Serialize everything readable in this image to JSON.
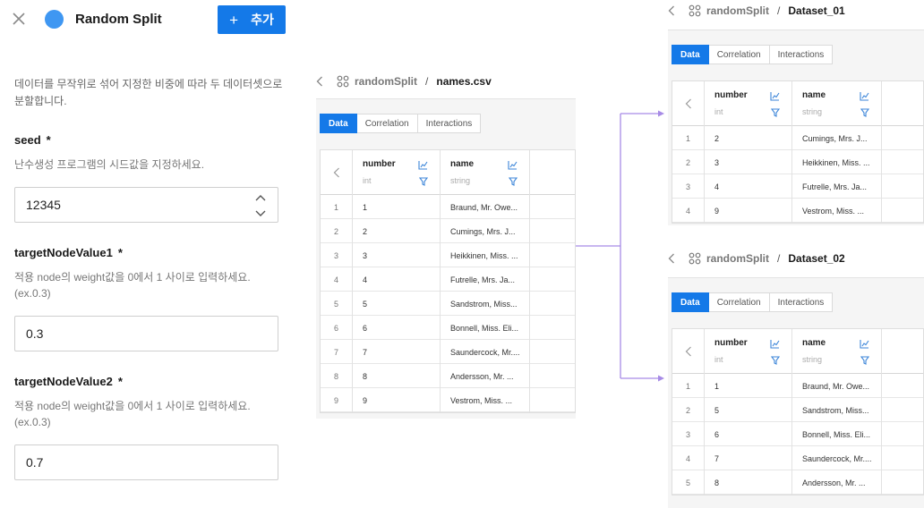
{
  "panel": {
    "title": "Random Split",
    "add_label": "추가",
    "description": "데이터를 무작위로 섞어 지정한 비중에 따라 두 데이터셋으로 분할합니다.",
    "fields": [
      {
        "label": "seed",
        "required": "*",
        "help": "난수생성 프로그램의 시드값을 지정하세요.",
        "value": "12345"
      },
      {
        "label": "targetNodeValue1",
        "required": "*",
        "help": "적용 node의 weight값을 0에서 1 사이로 입력하세요. (ex.0.3)",
        "value": "0.3"
      },
      {
        "label": "targetNodeValue2",
        "required": "*",
        "help": "적용 node의 weight값을 0에서 1 사이로 입력하세요. (ex.0.3)",
        "value": "0.7"
      }
    ]
  },
  "nodes": {
    "source": {
      "parent": "randomSplit",
      "separator": "/",
      "current": "names.csv",
      "tabs": [
        "Data",
        "Correlation",
        "Interactions"
      ],
      "columns": [
        {
          "name": "number",
          "type": "int"
        },
        {
          "name": "name",
          "type": "string"
        }
      ],
      "rows": [
        [
          "1",
          "1",
          "Braund, Mr. Owe..."
        ],
        [
          "2",
          "2",
          "Cumings, Mrs. J..."
        ],
        [
          "3",
          "3",
          "Heikkinen, Miss. ..."
        ],
        [
          "4",
          "4",
          "Futrelle, Mrs. Ja..."
        ],
        [
          "5",
          "5",
          "Sandstrom, Miss..."
        ],
        [
          "6",
          "6",
          "Bonnell, Miss. Eli..."
        ],
        [
          "7",
          "7",
          "Saundercock, Mr...."
        ],
        [
          "8",
          "8",
          "Andersson, Mr. ..."
        ],
        [
          "9",
          "9",
          "Vestrom, Miss. ..."
        ]
      ]
    },
    "output1": {
      "parent": "randomSplit",
      "separator": "/",
      "current": "Dataset_01",
      "tabs": [
        "Data",
        "Correlation",
        "Interactions"
      ],
      "columns": [
        {
          "name": "number",
          "type": "int"
        },
        {
          "name": "name",
          "type": "string"
        }
      ],
      "rows": [
        [
          "1",
          "2",
          "Cumings, Mrs. J..."
        ],
        [
          "2",
          "3",
          "Heikkinen, Miss. ..."
        ],
        [
          "3",
          "4",
          "Futrelle, Mrs. Ja..."
        ],
        [
          "4",
          "9",
          "Vestrom, Miss. ..."
        ]
      ]
    },
    "output2": {
      "parent": "randomSplit",
      "separator": "/",
      "current": "Dataset_02",
      "tabs": [
        "Data",
        "Correlation",
        "Interactions"
      ],
      "columns": [
        {
          "name": "number",
          "type": "int"
        },
        {
          "name": "name",
          "type": "string"
        }
      ],
      "rows": [
        [
          "1",
          "1",
          "Braund, Mr. Owe..."
        ],
        [
          "2",
          "5",
          "Sandstrom, Miss..."
        ],
        [
          "3",
          "6",
          "Bonnell, Miss. Eli..."
        ],
        [
          "4",
          "7",
          "Saundercock, Mr...."
        ],
        [
          "5",
          "8",
          "Andersson, Mr. ..."
        ]
      ]
    }
  },
  "colors": {
    "accent": "#1479e8",
    "node_dot": "#3f97f2",
    "connector": "#a78be6"
  },
  "icons": {
    "close": "close-icon",
    "back": "chevron-left-icon",
    "dataset": "dataset-grid-icon",
    "chart": "chart-icon",
    "filter": "filter-icon",
    "spin_up": "chevron-up-icon",
    "spin_down": "chevron-down-icon"
  }
}
